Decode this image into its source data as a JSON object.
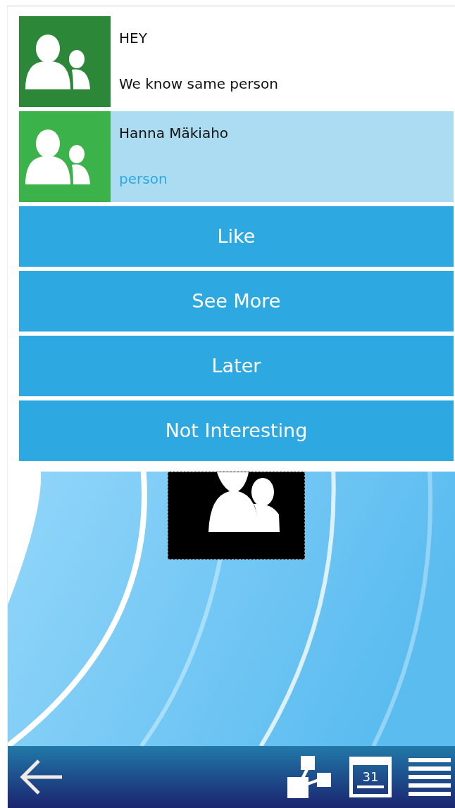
{
  "contacts": [
    {
      "title": "HEY",
      "subtitle": "We know same person",
      "selected": false
    },
    {
      "title": "Hanna Mäkiaho",
      "subtitle": "person",
      "selected": true
    }
  ],
  "actions": [
    "Like",
    "See More",
    "Later",
    "Not Interesting"
  ],
  "bottom_bar": {
    "calendar_day": "31"
  }
}
